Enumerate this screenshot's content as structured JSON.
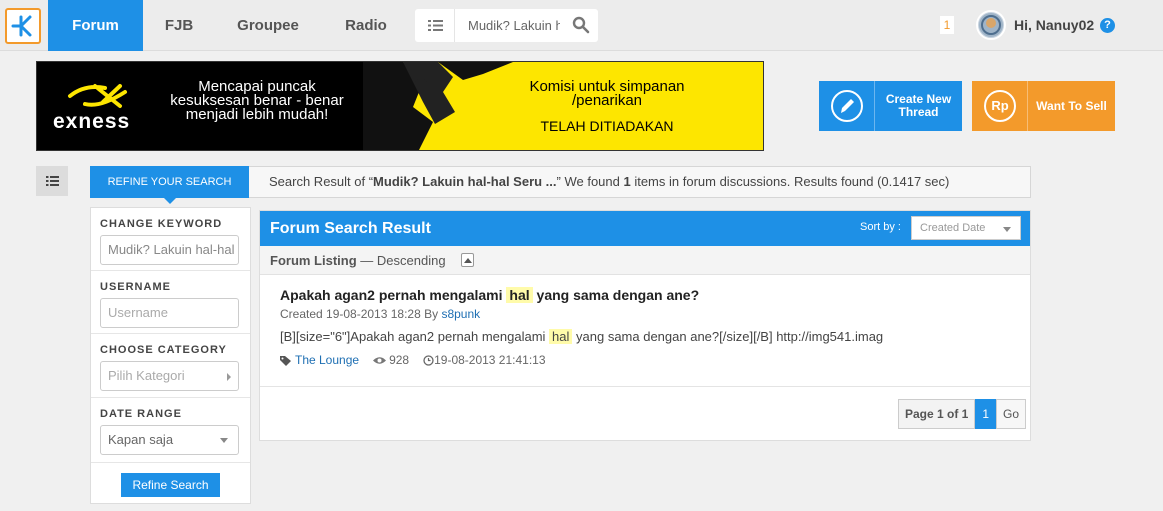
{
  "nav": {
    "tabs": [
      {
        "label": "Forum"
      },
      {
        "label": "FJB"
      },
      {
        "label": "Groupee"
      },
      {
        "label": "Radio"
      }
    ],
    "search_value": "Mudik? Lakuin h",
    "notification_count": "1",
    "greeting": "Hi, Nanuy02",
    "help": "?"
  },
  "banner": {
    "brand": "exness",
    "left_text": "Mencapai puncak kesuksesan benar - benar menjadi lebih mudah!",
    "right_text": "Komisi untuk simpanan /penarikan",
    "right_text2": "TELAH DITIADAKAN"
  },
  "actions": {
    "create_thread": "Create New Thread",
    "want_to_sell": "Want To Sell",
    "rp": "Rp"
  },
  "refine": {
    "tab_label": "REFINE YOUR SEARCH",
    "result_prefix": "Search Result of “",
    "result_query": "Mudik? Lakuin hal-hal Seru ...",
    "result_mid": "” We found ",
    "result_count": "1",
    "result_suffix": " items in forum discussions. Results found (0.1417 sec)"
  },
  "sidebar": {
    "keyword_heading": "CHANGE KEYWORD",
    "keyword_value": "Mudik? Lakuin hal-hal",
    "username_heading": "USERNAME",
    "username_placeholder": "Username",
    "category_heading": "CHOOSE CATEGORY",
    "category_placeholder": "Pilih Kategori",
    "date_heading": "DATE RANGE",
    "date_value": "Kapan saja",
    "refine_button": "Refine Search"
  },
  "main": {
    "title": "Forum Search Result",
    "sort_label": "Sort by :",
    "sort_value": "Created Date",
    "listing_label": "Forum Listing",
    "listing_order": " — Descending",
    "post": {
      "title_before": "Apakah agan2 pernah mengalami ",
      "title_highlight": "hal",
      "title_after": " yang sama dengan ane?",
      "created_prefix": "Created 19-08-2013 18:28 By ",
      "author": "s8punk",
      "body_before": "[B][size=\"6\"]Apakah agan2 pernah mengalami ",
      "body_highlight": "hal",
      "body_after": " yang sama dengan ane?[/size][/B] http://img541.imag",
      "category": "The Lounge",
      "views": "928",
      "last_post": "19-08-2013 21:41:13"
    },
    "pager": {
      "page_of": "Page 1 of 1",
      "current": "1",
      "go": "Go"
    }
  }
}
